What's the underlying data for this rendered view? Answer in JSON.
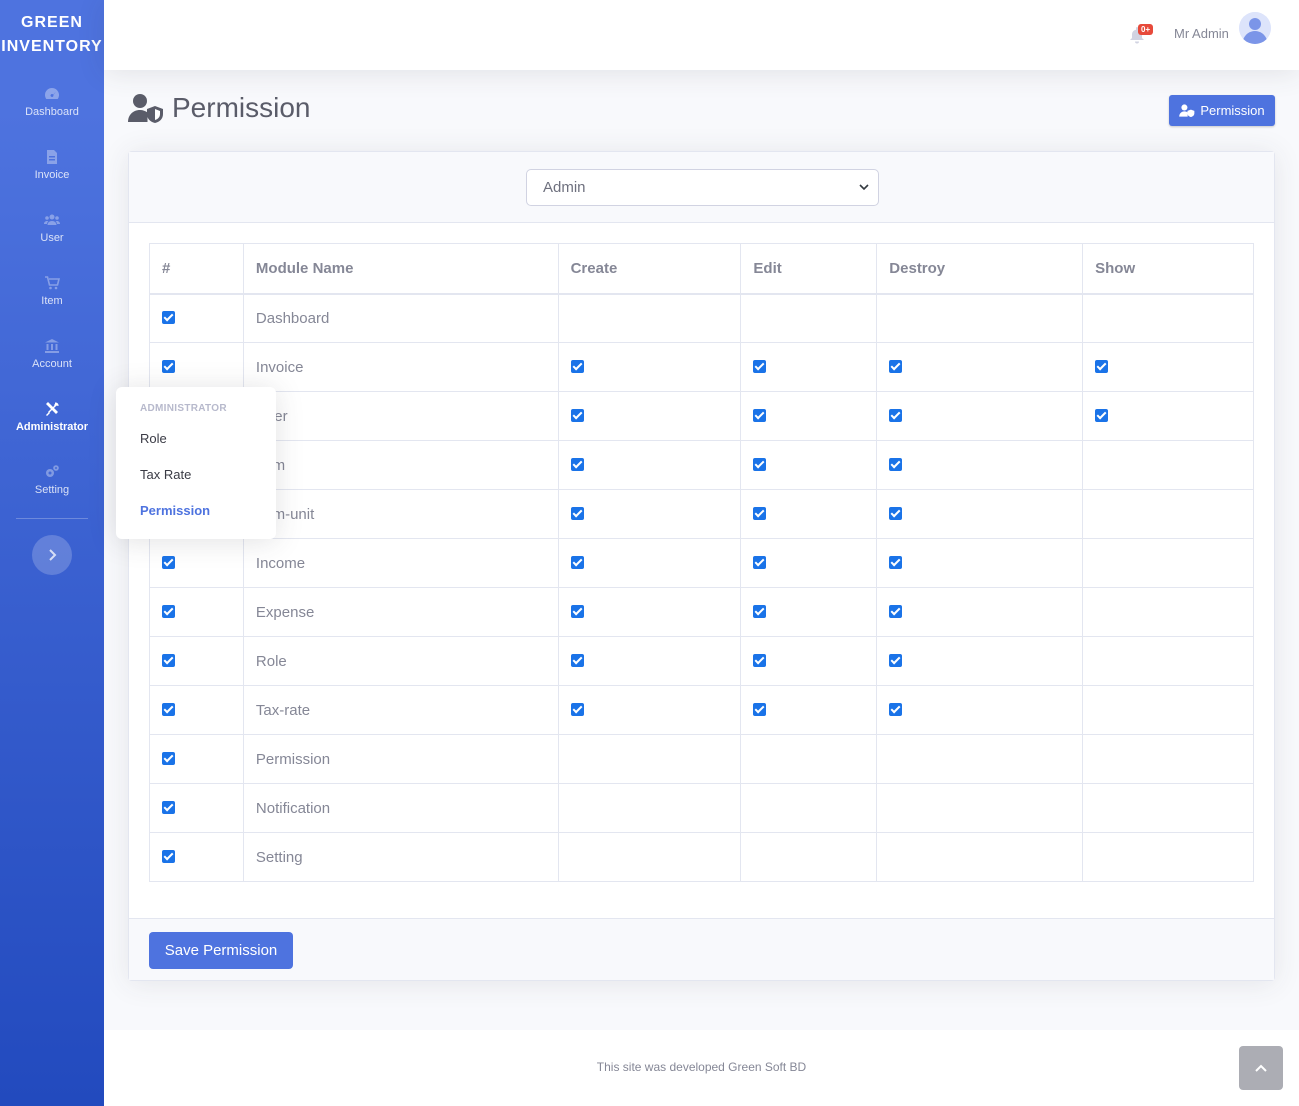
{
  "brand": {
    "line1": "GREEN",
    "line2": "INVENTORY"
  },
  "sidebar": {
    "items": [
      {
        "label": "Dashboard",
        "icon": "tachometer-icon"
      },
      {
        "label": "Invoice",
        "icon": "file-invoice-icon"
      },
      {
        "label": "User",
        "icon": "users-icon"
      },
      {
        "label": "Item",
        "icon": "cart-icon"
      },
      {
        "label": "Account",
        "icon": "bank-icon"
      },
      {
        "label": "Administrator",
        "icon": "tools-icon",
        "active": true
      },
      {
        "label": "Setting",
        "icon": "cogs-icon"
      }
    ],
    "toggle_icon": "chevron-right-icon"
  },
  "flyout": {
    "header": "ADMINISTRATOR",
    "items": [
      {
        "label": "Role"
      },
      {
        "label": "Tax Rate"
      },
      {
        "label": "Permission",
        "active": true
      }
    ]
  },
  "topbar": {
    "notification_badge": "0+",
    "user_name": "Mr Admin"
  },
  "page": {
    "title": "Permission",
    "action_button": "Permission"
  },
  "role_select": {
    "value": "Admin"
  },
  "table": {
    "headers": [
      "#",
      "Module Name",
      "Create",
      "Edit",
      "Destroy",
      "Show"
    ],
    "rows": [
      {
        "name": "Dashboard",
        "checked": true,
        "create": false,
        "edit": false,
        "destroy": false,
        "show": false
      },
      {
        "name": "Invoice",
        "checked": true,
        "create": true,
        "edit": true,
        "destroy": true,
        "show": true
      },
      {
        "name": "User",
        "checked": true,
        "create": true,
        "edit": true,
        "destroy": true,
        "show": true
      },
      {
        "name": "Item",
        "checked": true,
        "create": true,
        "edit": true,
        "destroy": true,
        "show": false
      },
      {
        "name": "Item-unit",
        "checked": true,
        "create": true,
        "edit": true,
        "destroy": true,
        "show": false
      },
      {
        "name": "Income",
        "checked": true,
        "create": true,
        "edit": true,
        "destroy": true,
        "show": false
      },
      {
        "name": "Expense",
        "checked": true,
        "create": true,
        "edit": true,
        "destroy": true,
        "show": false
      },
      {
        "name": "Role",
        "checked": true,
        "create": true,
        "edit": true,
        "destroy": true,
        "show": false
      },
      {
        "name": "Tax-rate",
        "checked": true,
        "create": true,
        "edit": true,
        "destroy": true,
        "show": false
      },
      {
        "name": "Permission",
        "checked": true,
        "create": false,
        "edit": false,
        "destroy": false,
        "show": false
      },
      {
        "name": "Notification",
        "checked": true,
        "create": false,
        "edit": false,
        "destroy": false,
        "show": false
      },
      {
        "name": "Setting",
        "checked": true,
        "create": false,
        "edit": false,
        "destroy": false,
        "show": false
      }
    ]
  },
  "save_button": "Save Permission",
  "footer": {
    "text": "This site was developed Green Soft BD"
  },
  "colors": {
    "primary": "#4e73df",
    "danger": "#e74a3b",
    "checkbox": "#1a73e8"
  }
}
